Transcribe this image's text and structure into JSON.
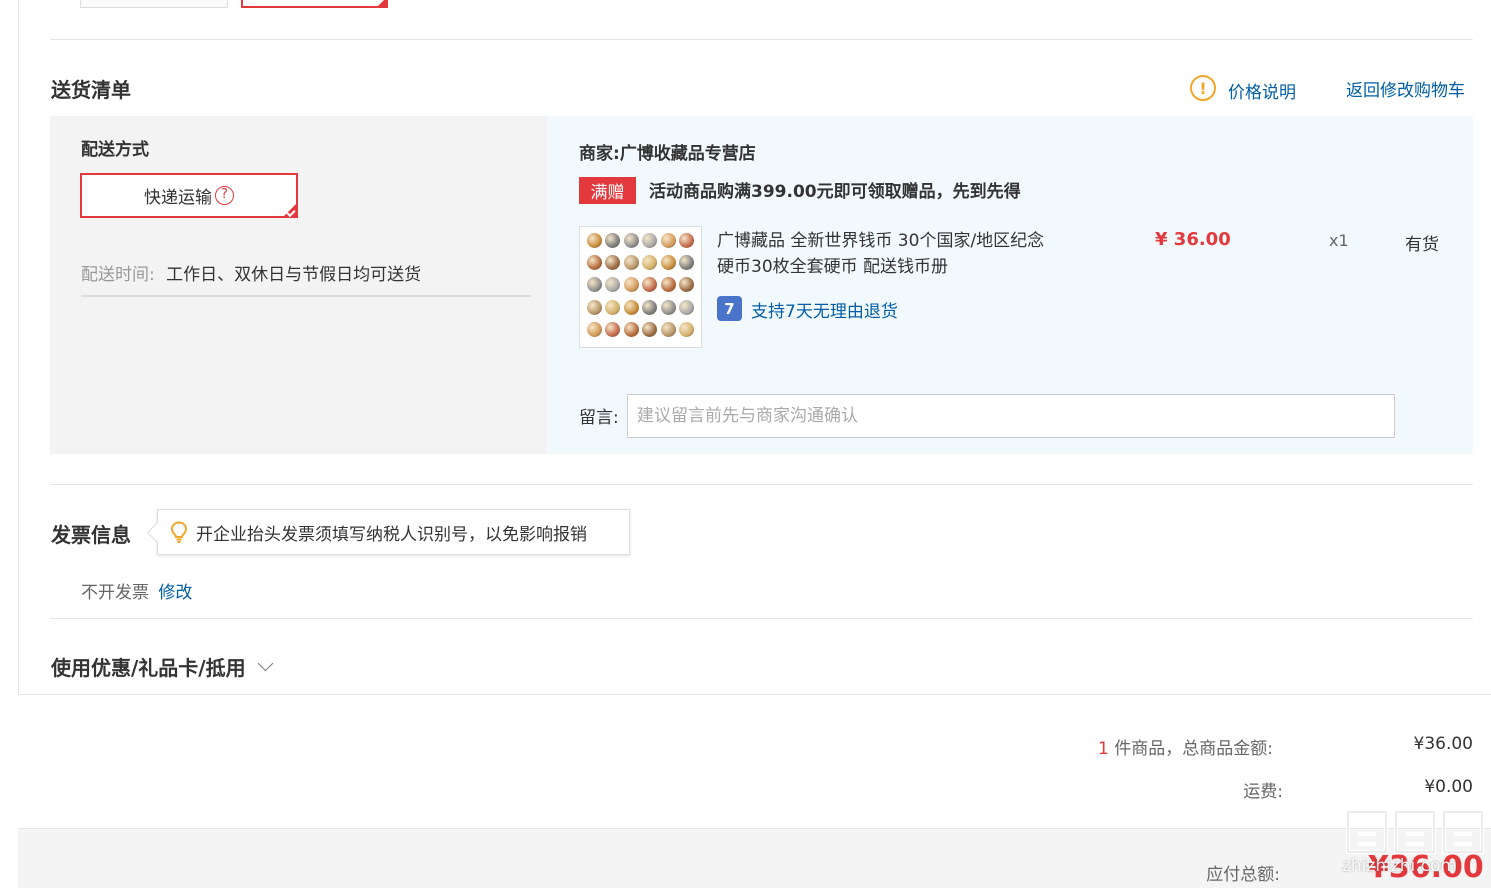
{
  "delivery": {
    "title": "送货清单",
    "price_note_link": "价格说明",
    "back_to_cart_link": "返回修改购物车",
    "method_label": "配送方式",
    "method_option": "快递运输",
    "time_label": "配送时间:",
    "time_value": "工作日、双休日与节假日均可送货"
  },
  "merchant": {
    "label": "商家:",
    "name": "广博收藏品专营店"
  },
  "promo": {
    "badge": "满赠",
    "text": "活动商品购满399.00元即可领取赠品，先到先得"
  },
  "product": {
    "name_line1": "广博藏品 全新世界钱币 30个国家/地区纪念",
    "name_line2": "硬币30枚全套硬币 配送钱币册",
    "price": "¥ 36.00",
    "quantity": "x1",
    "stock": "有货",
    "return_icon": "7",
    "return_policy": "支持7天无理由退货"
  },
  "message": {
    "label": "留言:",
    "placeholder": "建议留言前先与商家沟通确认",
    "value": ""
  },
  "invoice": {
    "title": "发票信息",
    "tip": "开企业抬头发票须填写纳税人识别号，以免影响报销",
    "status": "不开发票",
    "edit_link": "修改"
  },
  "coupon": {
    "title": "使用优惠/礼品卡/抵用"
  },
  "summary": {
    "item_count": "1",
    "item_label": "件商品，总商品金额:",
    "item_total": "¥36.00",
    "shipping_label": "运费:",
    "shipping_value": "¥0.00",
    "payable_label": "应付总额:",
    "payable_value": "¥36.00"
  },
  "watermark": {
    "text": "zhizhizhi.com"
  },
  "colors": {
    "accent_red": "#e4393c",
    "link_blue": "#005ea7",
    "warning_orange": "#f0a72a"
  }
}
